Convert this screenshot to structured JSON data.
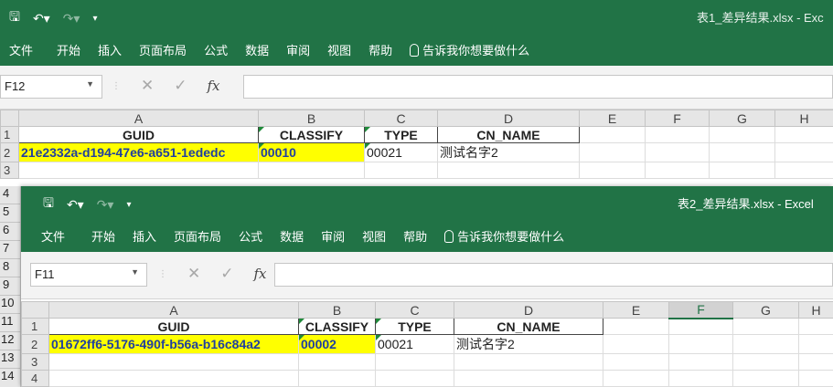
{
  "window1": {
    "title": "表1_差异结果.xlsx  -  Exc",
    "menu": [
      "文件",
      "开始",
      "插入",
      "页面布局",
      "公式",
      "数据",
      "审阅",
      "视图",
      "帮助"
    ],
    "tell_me": "告诉我你想要做什么",
    "namebox": "F12",
    "columns": [
      "A",
      "B",
      "C",
      "D",
      "E",
      "F",
      "G",
      "H"
    ],
    "rows": [
      "1",
      "2",
      "3"
    ],
    "headers": {
      "a": "GUID",
      "b": "CLASSIFY",
      "c": "TYPE",
      "d": "CN_NAME"
    },
    "row2": {
      "a": "21e2332a-d194-47e6-a651-1ededc",
      "b": "00010",
      "c": "00021",
      "d": "测试名字2"
    }
  },
  "window2": {
    "title": "表2_差异结果.xlsx  -  Excel",
    "menu": [
      "文件",
      "开始",
      "插入",
      "页面布局",
      "公式",
      "数据",
      "审阅",
      "视图",
      "帮助"
    ],
    "tell_me": "告诉我你想要做什么",
    "namebox": "F11",
    "columns": [
      "A",
      "B",
      "C",
      "D",
      "E",
      "F",
      "G",
      "H"
    ],
    "rows": [
      "1",
      "2",
      "3",
      "4"
    ],
    "headers": {
      "a": "GUID",
      "b": "CLASSIFY",
      "c": "TYPE",
      "d": "CN_NAME"
    },
    "row2": {
      "a": "01672ff6-5176-490f-b56a-b16c84a2",
      "b": "00002",
      "c": "00021",
      "d": "测试名字2"
    }
  },
  "outer_row_numbers": [
    "4",
    "5",
    "6",
    "7",
    "8",
    "9",
    "10",
    "11",
    "12",
    "13",
    "14"
  ],
  "colors": {
    "excel_green": "#217346",
    "highlight": "#ffff00",
    "text_blue": "#1f3f9f"
  }
}
